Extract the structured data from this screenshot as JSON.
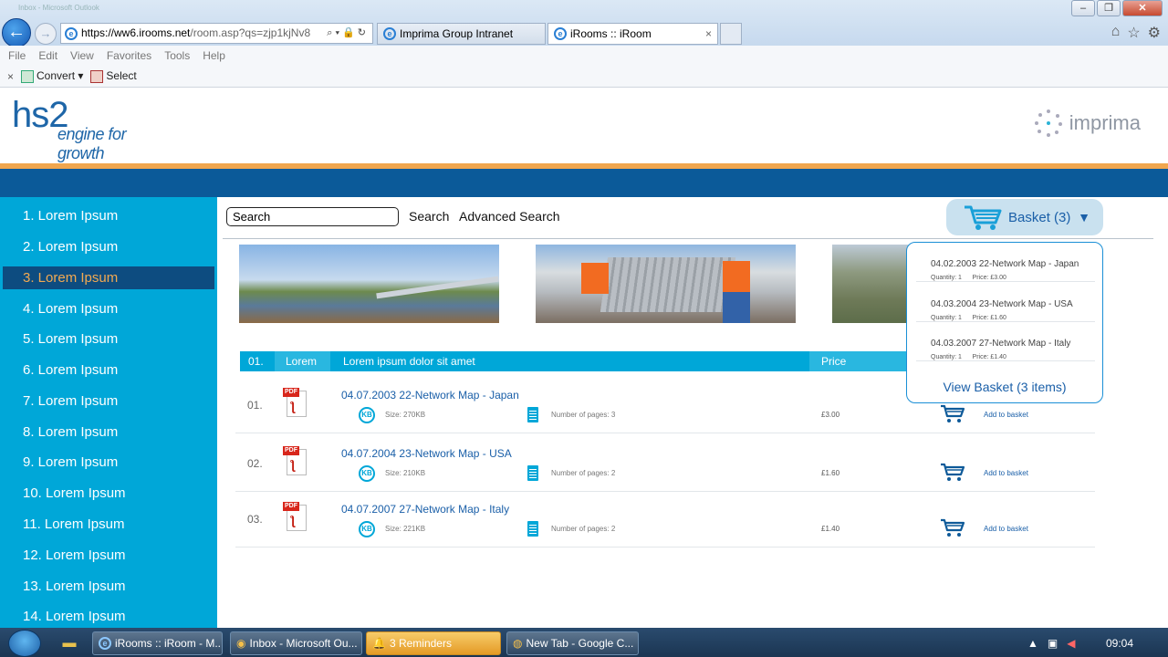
{
  "browser": {
    "background_window_title": "Inbox - Microsoft Outlook",
    "address": {
      "domain": "https://ww6.irooms.net",
      "path": "/room.asp?qs=zjp1kjNv8"
    },
    "tabs": [
      {
        "label": "Imprima Group Intranet"
      },
      {
        "label": "iRooms :: iRoom",
        "close": "×"
      }
    ],
    "menu": [
      "File",
      "Edit",
      "View",
      "Favorites",
      "Tools",
      "Help"
    ],
    "commands": {
      "close": "×",
      "convert": "Convert",
      "select": "Select"
    }
  },
  "header": {
    "logo_main": "hs2",
    "logo_tagline": "engine for growth",
    "partner_logo": "imprima"
  },
  "sidebar": {
    "items": [
      "1. Lorem Ipsum",
      "2. Lorem Ipsum",
      "3. Lorem Ipsum",
      "4. Lorem Ipsum",
      "5. Lorem Ipsum",
      "6. Lorem Ipsum",
      "7. Lorem Ipsum",
      "8. Lorem Ipsum",
      "9. Lorem Ipsum",
      "10. Lorem Ipsum",
      "11. Lorem Ipsum",
      "12. Lorem Ipsum",
      "13. Lorem Ipsum",
      "14. Lorem Ipsum"
    ],
    "active_index": 2
  },
  "toolbar": {
    "search_value": "Search",
    "search_label": "Search",
    "advanced_search_label": "Advanced Search",
    "basket_label": "Basket (3)"
  },
  "table": {
    "headers": [
      "01.",
      "Lorem",
      "Lorem ipsum dolor sit amet",
      "Price"
    ],
    "rows": [
      {
        "num": "01.",
        "title": "04.07.2003 22-Network Map - Japan",
        "size": "Size: 270KB",
        "pages": "Number of pages: 3",
        "price": "£3.00",
        "action": "Add to basket"
      },
      {
        "num": "02.",
        "title": "04.07.2004 23-Network Map - USA",
        "size": "Size: 210KB",
        "pages": "Number of pages: 2",
        "price": "£1.60",
        "action": "Add to basket"
      },
      {
        "num": "03.",
        "title": "04.07.2007 27-Network Map - Italy",
        "size": "Size: 221KB",
        "pages": "Number of pages: 2",
        "price": "£1.40",
        "action": "Add to basket"
      }
    ],
    "kb_badge": "KB",
    "pdf_badge": "PDF"
  },
  "basket_dropdown": {
    "items": [
      {
        "title": "04.02.2003 22-Network Map - Japan",
        "meta": "Quantity: 1      Price: £3.00"
      },
      {
        "title": "04.03.2004 23-Network Map - USA",
        "meta": "Quantity: 1      Price: £1.60"
      },
      {
        "title": "04.03.2007 27-Network Map - Italy",
        "meta": "Quantity: 1      Price: £1.40"
      }
    ],
    "view_label": "View Basket (3 items)"
  },
  "taskbar": {
    "tasks": [
      {
        "label": "iRooms :: iRoom - M..."
      },
      {
        "label": "Inbox - Microsoft Ou..."
      },
      {
        "label": "3 Reminders"
      },
      {
        "label": "New Tab - Google C..."
      }
    ],
    "clock": "09:04"
  },
  "colors": {
    "accent": "#00a7d8",
    "nav_dark": "#0d4c80",
    "active_text": "#f3a951",
    "header_band": "#0b5a99",
    "orange_band": "#f0a64e",
    "link": "#1a5fa8"
  }
}
